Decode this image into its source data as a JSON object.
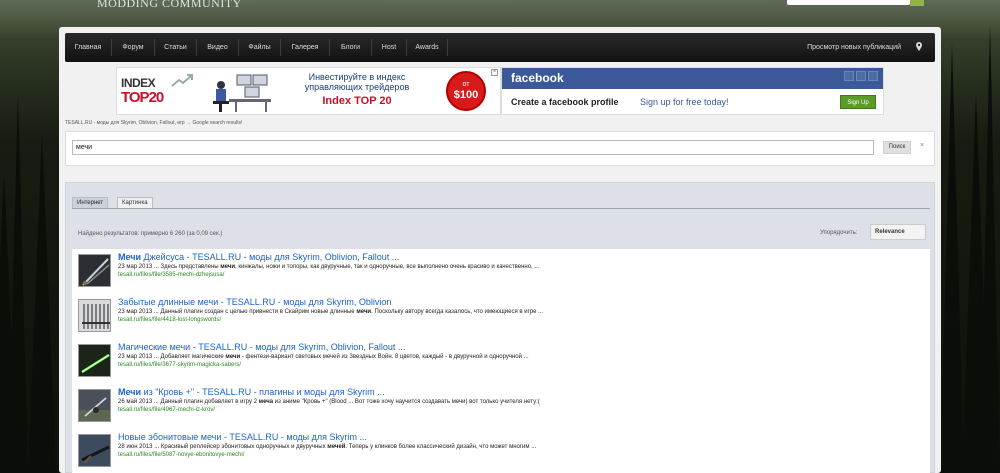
{
  "site": {
    "title": "MODDING COMMUNITY"
  },
  "nav": {
    "items": [
      "Главная",
      "Форум",
      "Статьи",
      "Видео",
      "Файлы",
      "Галерея",
      "Блоги",
      "Host",
      "Awards"
    ],
    "new_posts": "Просмотр новых публикаций"
  },
  "ad_index": {
    "logo_line1": "INDEX",
    "logo_line2": "TOP20",
    "headline": "Инвестируйте в индекс управляющих трейдеров",
    "brand": "Index TOP 20",
    "badge_from": "от",
    "badge_value": "$100"
  },
  "ad_facebook": {
    "logo": "facebook",
    "create": "Create a facebook profile",
    "signup": "Sign up for free today!",
    "button": "Sign Up"
  },
  "breadcrumb": "TESALL.RU - моды для Skyrim, Oblivion, Fallout, игр  →  Google search results!",
  "search": {
    "query": "мечи",
    "button": "Поиск",
    "clear": "×"
  },
  "tabs": [
    "Интернет",
    "Картинка"
  ],
  "stats": "Найдено результатов: примерно 6 260 (за 0,09 сек.)",
  "sort": {
    "label": "Упорядочить:",
    "value": "Relevance"
  },
  "results": [
    {
      "title_bold": "Мечи",
      "title_rest": " Джейсуса - TESALL.RU - моды для Skyrim, Oblivion, Fallout ...",
      "snippet_pre": "23 мар 2013 ... Здесь представлены ",
      "snippet_bold": "мечи",
      "snippet_post": ", кинжалы, ножи и топоры, как двуручные, так и одноручные, все выполнено очень красиво и качественно, ...",
      "url": "tesall.ru/files/file/3585-mechi-dzhejsusa/"
    },
    {
      "title_bold": "Забытые длинные мечи",
      "title_rest": " - TESALL.RU - моды для Skyrim, Oblivion",
      "snippet_pre": "23 мар 2013 ... Данный плагин создан с целью привнести в Скайрим новые длинные ",
      "snippet_bold": "мечи",
      "snippet_post": ". Поскольку автору всегда казалось, что имеющиеся в игре ...",
      "url": "tesall.ru/files/file/4418-lost-longswords/"
    },
    {
      "title_bold": "Магические мечи",
      "title_rest": " - TESALL.RU - моды для Skyrim, Oblivion, Fallout ...",
      "snippet_pre": "23 мар 2013 ... Добавляет магические ",
      "snippet_bold": "мечи",
      "snippet_post": " - фентези-вариант световых мечей из Звездных Войн. 8 цветов, каждый - в двуручной и одноручной ...",
      "url": "tesall.ru/files/file/3677-skyrim-magicka-sabers/"
    },
    {
      "title_bold": "Мечи",
      "title_rest": " из \"Кровь +\" - TESALL.RU - плагины и моды для Skyrim ...",
      "snippet_pre": "26 май 2013 ... Данный плагин добавляет в игру 2 ",
      "snippet_bold": "меча",
      "snippet_post": " из аниме \"Кровь +\" (Blood ... Вот тоже хочу научится создавать мечи) вот только учителя нету:(",
      "url": "tesall.ru/files/file/4967-mechi-iz-krov/"
    },
    {
      "title_bold": "Новые эбонитовые мечи",
      "title_rest": " - TESALL.RU - моды для Skyrim ...",
      "snippet_pre": "28 июн 2013 ... Красивый реплейсер эбонитовых одноручных и двуручных ",
      "snippet_bold": "мечей",
      "snippet_post": ". Теперь у клинков более классический дизайн, что может многим ...",
      "url": "tesall.ru/files/file/5087-novye-ebonitovye-mechi/"
    }
  ]
}
